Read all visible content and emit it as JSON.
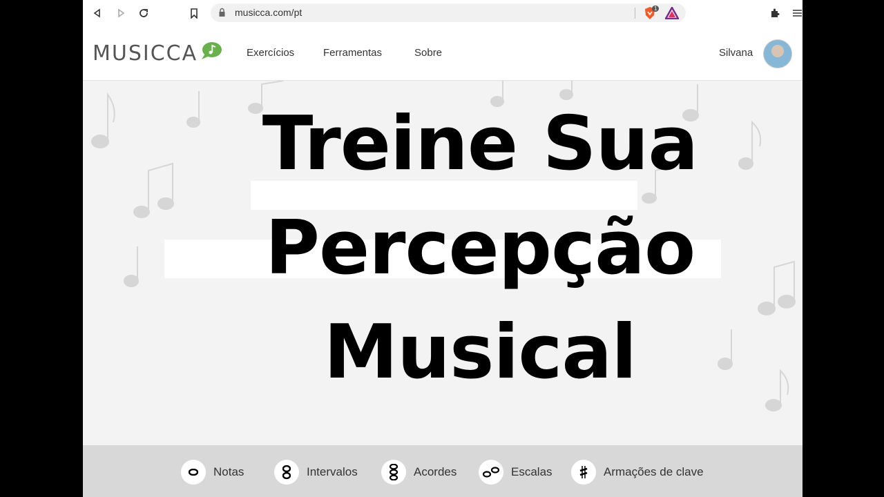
{
  "browser": {
    "url": "musicca.com/pt",
    "badge_count": "1",
    "back_icon": "back-arrow-icon",
    "forward_icon": "forward-arrow-icon",
    "reload_icon": "reload-icon",
    "bookmark_icon": "bookmark-icon"
  },
  "header": {
    "logo": "MUSICCA",
    "nav": [
      "Exercícios",
      "Ferramentas",
      "Sobre"
    ],
    "user_name": "Silvana"
  },
  "hero": {
    "title_lines": [
      "Treine Sua",
      "Percepção",
      "Musical"
    ]
  },
  "exercises": [
    {
      "label": "Notas",
      "icon": "whole-note-icon",
      "glyph": "o"
    },
    {
      "label": "Intervalos",
      "icon": "interval-notes-icon",
      "glyph": "8"
    },
    {
      "label": "Acordes",
      "icon": "chord-notes-icon",
      "glyph": "8"
    },
    {
      "label": "Escalas",
      "icon": "scale-notes-icon",
      "glyph": "oo"
    },
    {
      "label": "Armações de clave",
      "icon": "sharp-icon",
      "glyph": "♯"
    }
  ],
  "colors": {
    "logo_green": "#6ab04c",
    "exercise_bar": "#d8d8d8",
    "hero_bg": "#f3f3f3"
  }
}
